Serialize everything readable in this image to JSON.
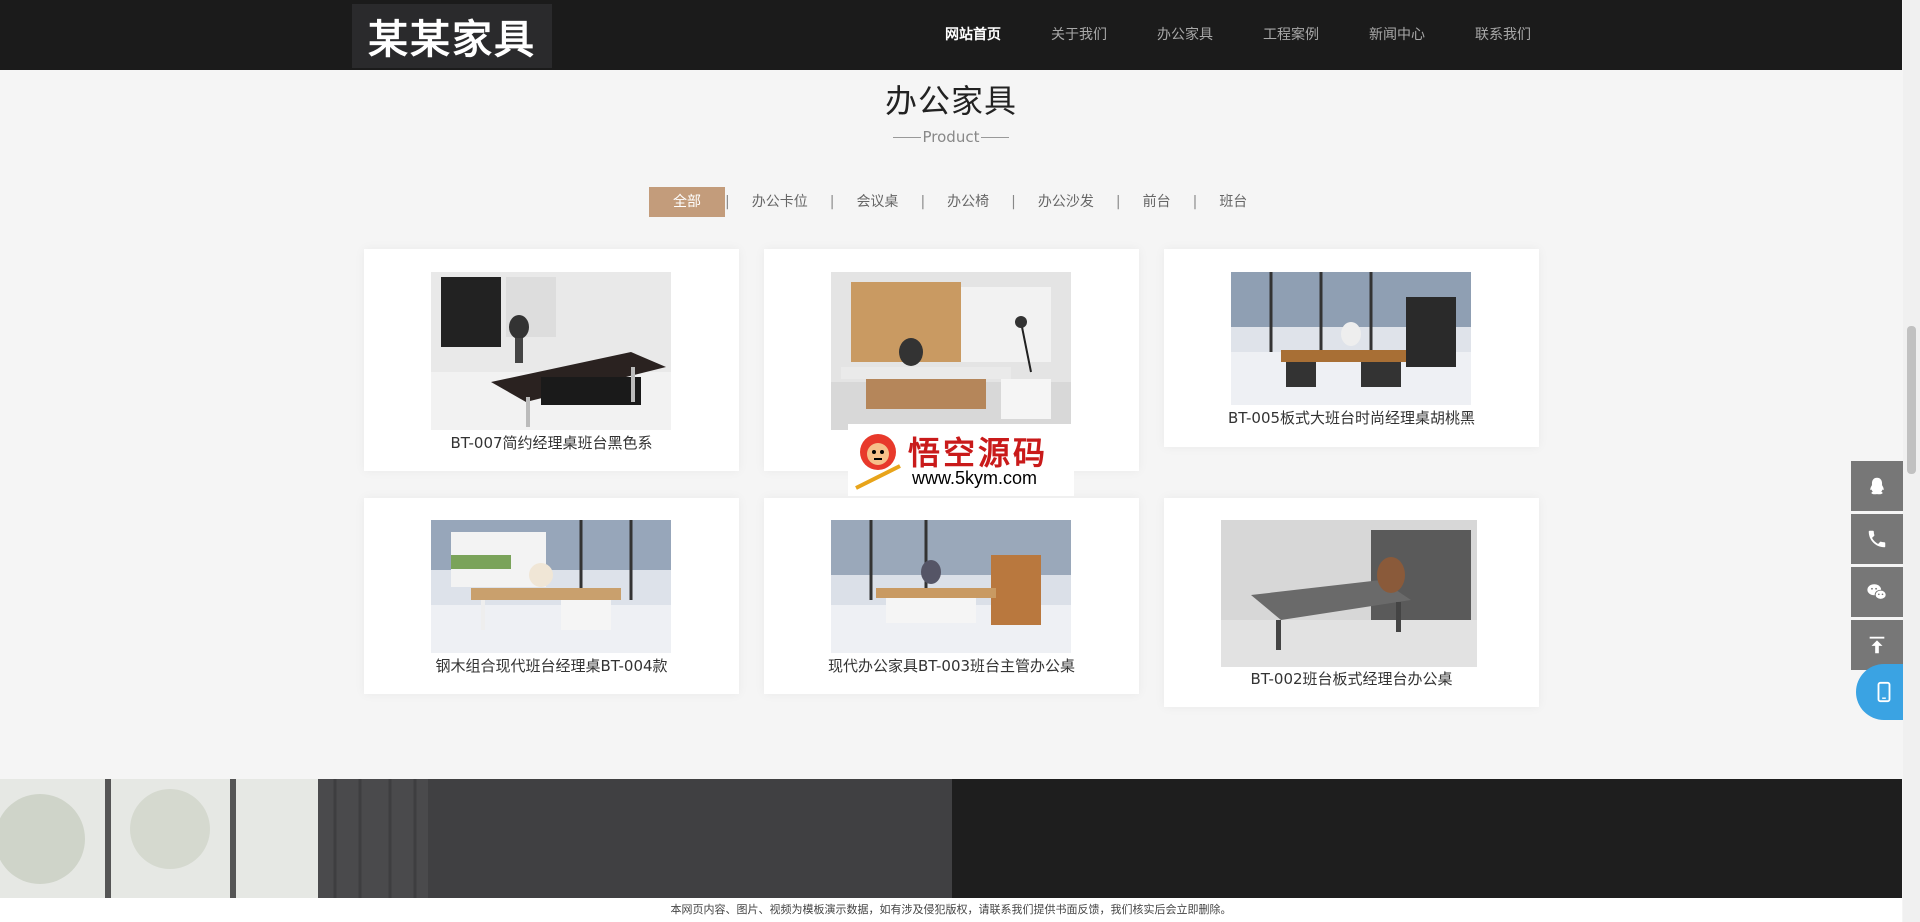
{
  "logo": "某某家具",
  "nav": [
    {
      "label": "网站首页",
      "active": true
    },
    {
      "label": "关于我们",
      "active": false
    },
    {
      "label": "办公家具",
      "active": false
    },
    {
      "label": "工程案例",
      "active": false
    },
    {
      "label": "新闻中心",
      "active": false
    },
    {
      "label": "联系我们",
      "active": false
    }
  ],
  "section": {
    "title": "办公家具",
    "subtitle": "Product"
  },
  "tabs": [
    {
      "label": "全部",
      "active": true
    },
    {
      "label": "办公卡位"
    },
    {
      "label": "会议桌"
    },
    {
      "label": "办公椅"
    },
    {
      "label": "办公沙发"
    },
    {
      "label": "前台"
    },
    {
      "label": "班台"
    }
  ],
  "tab_separator": "|",
  "products": [
    {
      "title": "BT-007简约经理桌班台黑色系"
    },
    {
      "title": ""
    },
    {
      "title": "BT-005板式大班台时尚经理桌胡桃黑"
    },
    {
      "title": "钢木组合现代班台经理桌BT-004款"
    },
    {
      "title": "现代办公家具BT-003班台主管办公桌"
    },
    {
      "title": "BT-002班台板式经理台办公桌"
    }
  ],
  "watermark": {
    "cn": "悟空源码",
    "url": "www.5kym.com"
  },
  "float_icons": [
    "qq-icon",
    "phone-icon",
    "wechat-icon",
    "back-to-top-icon",
    "mobile-icon"
  ],
  "footer_note": "本网页内容、图片、视频为模板演示数据，如有涉及侵犯版权，请联系我们提供书面反馈，我们核实后会立即删除。",
  "colors": {
    "header_bg": "#1b1b1b",
    "accent": "#c39c7b",
    "mobile_btn": "#3aa3e3",
    "float_bg": "#777777"
  }
}
